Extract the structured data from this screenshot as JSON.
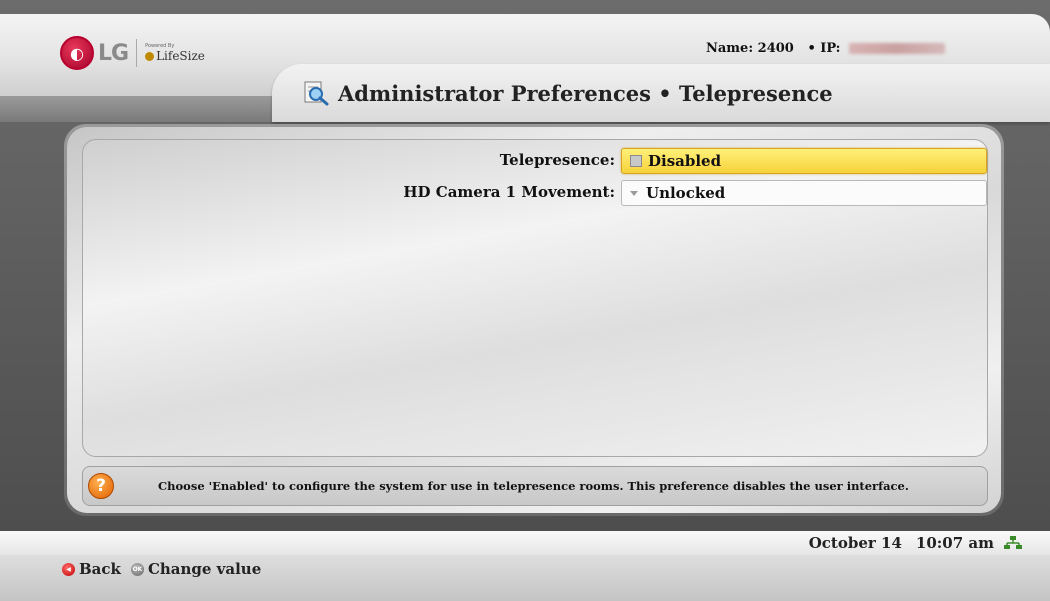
{
  "header": {
    "brand": "LG",
    "powered_by": "Powered By",
    "partner": "LifeSize",
    "name_label": "Name:",
    "name_value": "2400",
    "ip_label": "• IP:"
  },
  "page": {
    "title": "Administrator Preferences • Telepresence"
  },
  "settings": [
    {
      "label": "Telepresence:",
      "value": "Disabled"
    },
    {
      "label": "HD Camera 1 Movement:",
      "value": "Unlocked"
    }
  ],
  "help": {
    "icon": "?",
    "text": "Choose 'Enabled' to configure the system for use in telepresence rooms. This preference disables the user interface."
  },
  "status": {
    "date": "October 14",
    "time": "10:07 am"
  },
  "hints": {
    "back": "Back",
    "change": "Change value"
  },
  "colors": {
    "selected_field": "#f6d23a",
    "lg_red": "#a5002a",
    "help_orange": "#e06000"
  }
}
